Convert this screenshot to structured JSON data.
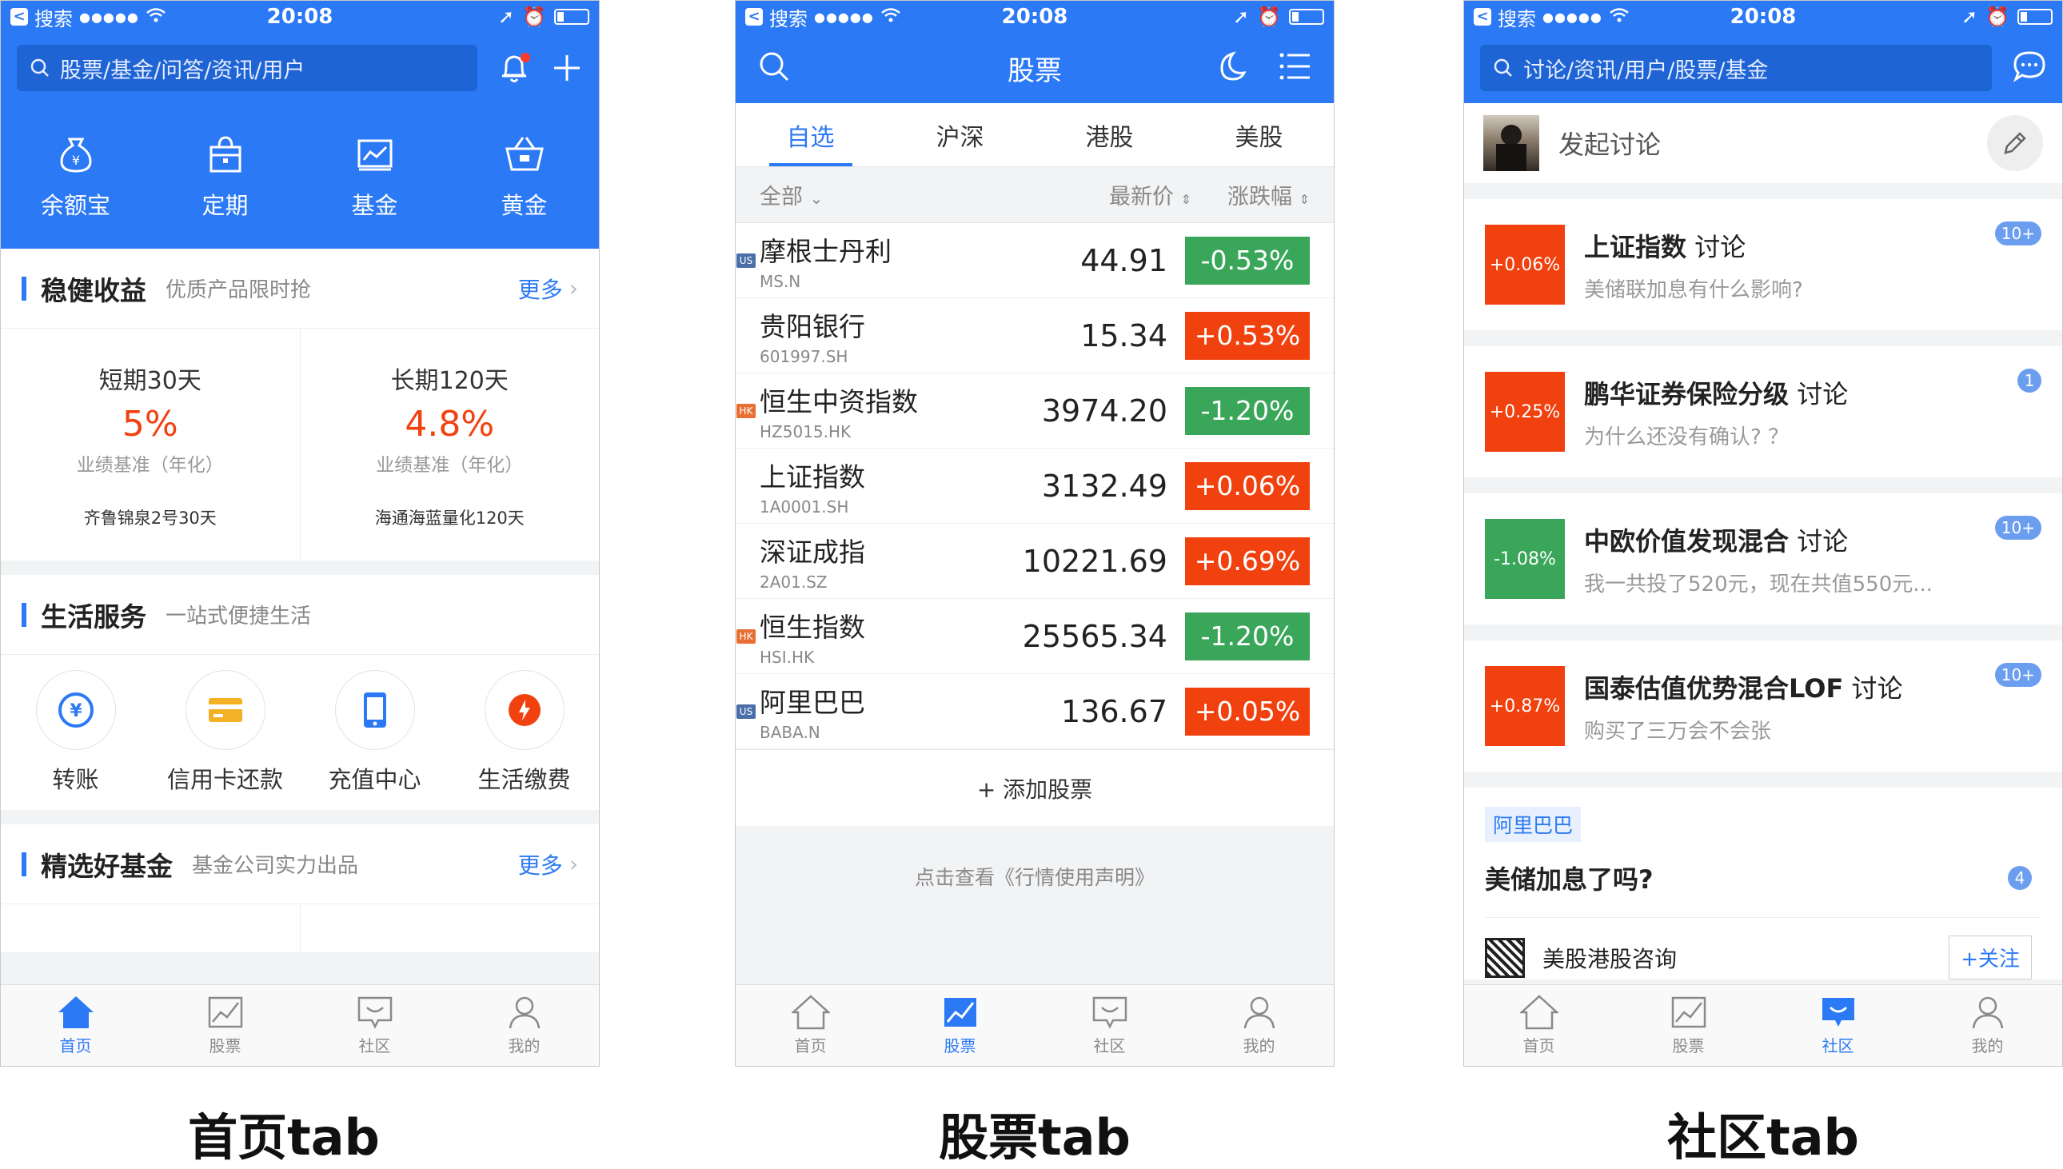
{
  "status": {
    "carrier": "搜索",
    "signal": "●●●●●",
    "time": "20:08"
  },
  "colors": {
    "accent": "#2b79f5",
    "up": "#f0410f",
    "down": "#3aa65a",
    "text": "#222222",
    "muted": "#888888"
  },
  "home": {
    "search_placeholder": "股票/基金/问答/资讯/用户",
    "quick": [
      {
        "label": "余额宝",
        "icon": "moneybag-icon"
      },
      {
        "label": "定期",
        "icon": "lock-bag-icon"
      },
      {
        "label": "基金",
        "icon": "fund-chart-icon"
      },
      {
        "label": "黄金",
        "icon": "gold-basket-icon"
      }
    ],
    "steady": {
      "title": "稳健收益",
      "subtitle": "优质产品限时抢",
      "more": "更多",
      "cards": [
        {
          "period": "短期30天",
          "rate": "5%",
          "rate_label": "业绩基准（年化）",
          "name": "齐鲁锦泉2号30天"
        },
        {
          "period": "长期120天",
          "rate": "4.8%",
          "rate_label": "业绩基准（年化）",
          "name": "海通海蓝量化120天"
        }
      ]
    },
    "life": {
      "title": "生活服务",
      "subtitle": "一站式便捷生活",
      "items": [
        {
          "label": "转账",
          "icon": "transfer-icon"
        },
        {
          "label": "信用卡还款",
          "icon": "credit-card-icon"
        },
        {
          "label": "充值中心",
          "icon": "phone-icon"
        },
        {
          "label": "生活缴费",
          "icon": "fire-icon"
        }
      ]
    },
    "funds": {
      "title": "精选好基金",
      "subtitle": "基金公司实力出品",
      "more": "更多"
    }
  },
  "stocks": {
    "title": "股票",
    "tabs": [
      "自选",
      "沪深",
      "港股",
      "美股"
    ],
    "header": {
      "all": "全部",
      "price": "最新价",
      "change": "涨跌幅"
    },
    "rows": [
      {
        "tag": "US",
        "name": "摩根士丹利",
        "code": "MS.N",
        "price": "44.91",
        "change": "-0.53%",
        "dir": "down"
      },
      {
        "tag": "",
        "name": "贵阳银行",
        "code": "601997.SH",
        "price": "15.34",
        "change": "+0.53%",
        "dir": "up"
      },
      {
        "tag": "HK",
        "name": "恒生中资指数",
        "code": "HZ5015.HK",
        "price": "3974.20",
        "change": "-1.20%",
        "dir": "down"
      },
      {
        "tag": "",
        "name": "上证指数",
        "code": "1A0001.SH",
        "price": "3132.49",
        "change": "+0.06%",
        "dir": "up"
      },
      {
        "tag": "",
        "name": "深证成指",
        "code": "2A01.SZ",
        "price": "10221.69",
        "change": "+0.69%",
        "dir": "up"
      },
      {
        "tag": "HK",
        "name": "恒生指数",
        "code": "HSI.HK",
        "price": "25565.34",
        "change": "-1.20%",
        "dir": "down"
      },
      {
        "tag": "US",
        "name": "阿里巴巴",
        "code": "BABA.N",
        "price": "136.67",
        "change": "+0.05%",
        "dir": "up"
      }
    ],
    "add": "+ 添加股票",
    "notice": "点击查看《行情使用声明》"
  },
  "community": {
    "search_placeholder": "讨论/资讯/用户/股票/基金",
    "compose": "发起讨论",
    "topics": [
      {
        "change": "+0.06%",
        "dir": "up",
        "name": "上证指数",
        "suffix": "讨论",
        "badge": "10+",
        "desc": "美储联加息有什么影响?"
      },
      {
        "change": "+0.25%",
        "dir": "up",
        "name": "鹏华证券保险分级",
        "suffix": "讨论",
        "badge": "1",
        "desc": "为什么还没有确认? ？"
      },
      {
        "change": "-1.08%",
        "dir": "down",
        "name": "中欧价值发现混合",
        "suffix": "讨论",
        "badge": "10+",
        "desc": "我一共投了520元，现在共值550元..."
      },
      {
        "change": "+0.87%",
        "dir": "up",
        "name": "国泰估值优势混合LOF",
        "suffix": "讨论",
        "badge": "10+",
        "desc": "购买了三万会不会张"
      }
    ],
    "post": {
      "tag": "阿里巴巴",
      "title": "美储加息了吗?",
      "badge": "4",
      "author": "美股港股咨询",
      "follow": "+关注"
    }
  },
  "nav": [
    "首页",
    "股票",
    "社区",
    "我的"
  ],
  "captions": [
    "首页tab",
    "股票tab",
    "社区tab"
  ]
}
